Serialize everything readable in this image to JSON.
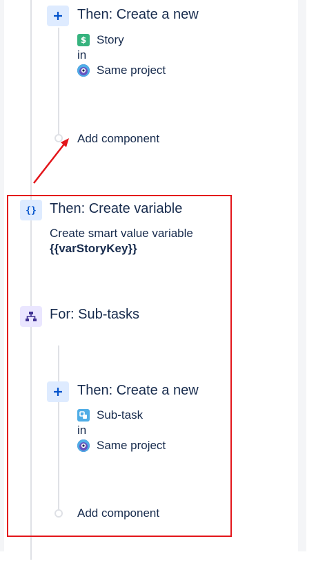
{
  "colors": {
    "highlight": "#e3151a",
    "icon_bg_blue": "#deebff",
    "icon_bg_purple": "#eae6ff",
    "story_green": "#36b37e",
    "subtask_blue": "#4fade6"
  },
  "block1": {
    "icon": "plus-icon",
    "title": "Then: Create a new",
    "issue_icon": "story-icon",
    "issue_type": "Story",
    "in_label": "in",
    "project_icon": "project-avatar-icon",
    "project": "Same project",
    "add_component": "Add component"
  },
  "block2": {
    "icon": "braces-icon",
    "title": "Then: Create variable",
    "desc": "Create smart value variable",
    "var_name": "{{varStoryKey}}"
  },
  "block3": {
    "icon": "hierarchy-icon",
    "title": "For: Sub-tasks"
  },
  "block4": {
    "icon": "plus-icon",
    "title": "Then: Create a new",
    "issue_icon": "subtask-icon",
    "issue_type": "Sub-task",
    "in_label": "in",
    "project_icon": "project-avatar-icon",
    "project": "Same project",
    "add_component": "Add component"
  }
}
